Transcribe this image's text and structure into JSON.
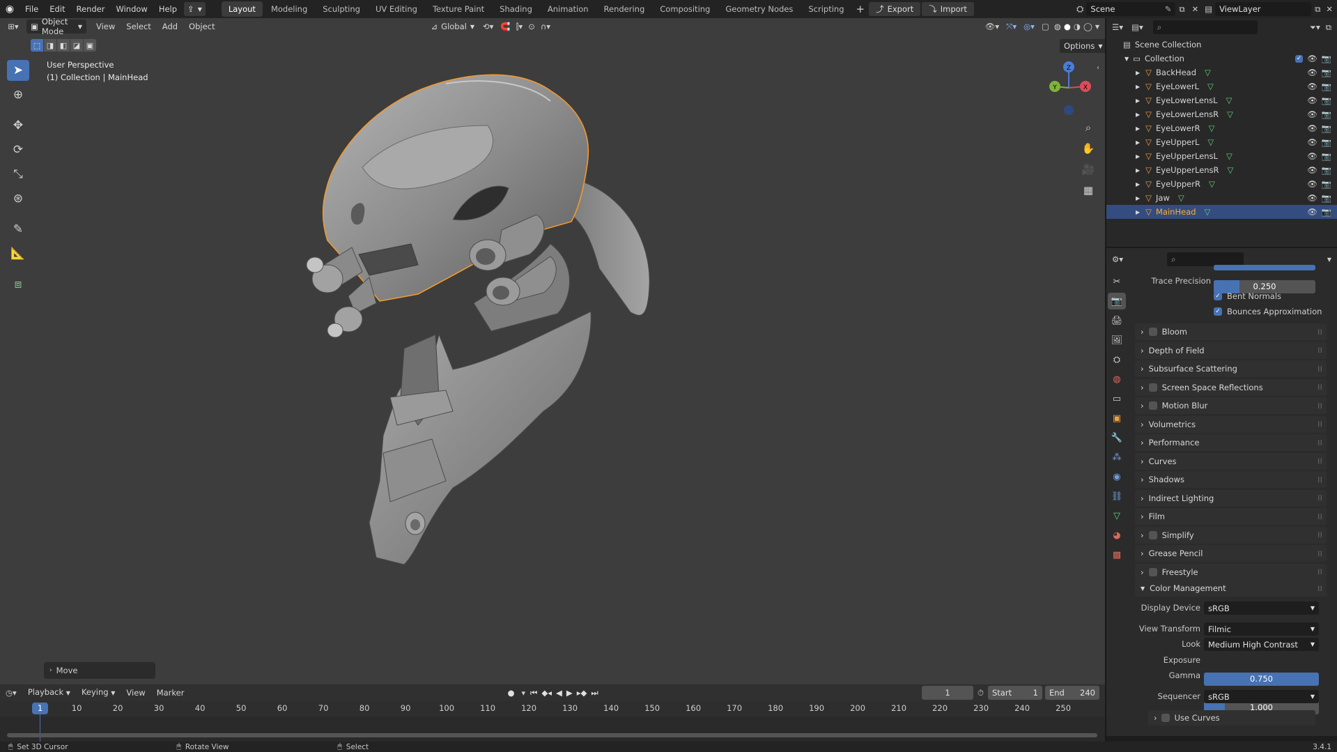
{
  "topbar": {
    "menus": [
      "File",
      "Edit",
      "Render",
      "Window",
      "Help"
    ],
    "workspaces": [
      "Layout",
      "Modeling",
      "Sculpting",
      "UV Editing",
      "Texture Paint",
      "Shading",
      "Animation",
      "Rendering",
      "Compositing",
      "Geometry Nodes",
      "Scripting"
    ],
    "active_workspace": "Layout",
    "export_label": "Export",
    "import_label": "Import",
    "scene": "Scene",
    "view_layer": "ViewLayer"
  },
  "viewport": {
    "mode": "Object Mode",
    "menus": [
      "View",
      "Select",
      "Add",
      "Object"
    ],
    "orientation": "Global",
    "options_label": "Options",
    "overlay_line1": "User Perspective",
    "overlay_line2": "(1) Collection | MainHead",
    "last_op": "Move",
    "gizmo_axes": {
      "z": "Z",
      "x": "X",
      "y": "Y"
    },
    "colors": {
      "background": "#3d3d3d",
      "selection_outline": "#f29a2e",
      "mesh": "#9a9a9a"
    }
  },
  "outliner": {
    "root": "Scene Collection",
    "collection": "Collection",
    "objects": [
      "BackHead",
      "EyeLowerL",
      "EyeLowerLensL",
      "EyeLowerLensR",
      "EyeLowerR",
      "EyeUpperL",
      "EyeUpperLensL",
      "EyeUpperLensR",
      "EyeUpperR",
      "Jaw",
      "MainHead"
    ],
    "selected": "MainHead"
  },
  "properties": {
    "trace_precision_label": "Trace Precision",
    "trace_precision_value": "0.250",
    "trace_precision_fraction": 0.25,
    "bent_normals": "Bent Normals",
    "bounces_approx": "Bounces Approximation",
    "panels": [
      {
        "label": "Bloom",
        "checkbox": true
      },
      {
        "label": "Depth of Field",
        "checkbox": false
      },
      {
        "label": "Subsurface Scattering",
        "checkbox": false
      },
      {
        "label": "Screen Space Reflections",
        "checkbox": true
      },
      {
        "label": "Motion Blur",
        "checkbox": true
      },
      {
        "label": "Volumetrics",
        "checkbox": false
      },
      {
        "label": "Performance",
        "checkbox": false
      },
      {
        "label": "Curves",
        "checkbox": false
      },
      {
        "label": "Shadows",
        "checkbox": false
      },
      {
        "label": "Indirect Lighting",
        "checkbox": false
      },
      {
        "label": "Film",
        "checkbox": false
      },
      {
        "label": "Simplify",
        "checkbox": true
      },
      {
        "label": "Grease Pencil",
        "checkbox": false
      },
      {
        "label": "Freestyle",
        "checkbox": true
      }
    ],
    "color_management": {
      "title": "Color Management",
      "display_device_label": "Display Device",
      "display_device": "sRGB",
      "view_transform_label": "View Transform",
      "view_transform": "Filmic",
      "look_label": "Look",
      "look": "Medium High Contrast",
      "exposure_label": "Exposure",
      "exposure": "0.750",
      "gamma_label": "Gamma",
      "gamma": "1.000",
      "sequencer_label": "Sequencer",
      "sequencer": "sRGB",
      "use_curves": "Use Curves"
    }
  },
  "timeline": {
    "menus": [
      "Playback",
      "Keying",
      "View",
      "Marker"
    ],
    "current_frame": "1",
    "start_label": "Start",
    "start": "1",
    "end_label": "End",
    "end": "240",
    "ticks": [
      "1",
      "10",
      "20",
      "30",
      "40",
      "50",
      "60",
      "70",
      "80",
      "90",
      "100",
      "110",
      "120",
      "130",
      "140",
      "150",
      "160",
      "170",
      "180",
      "190",
      "200",
      "210",
      "220",
      "230",
      "240",
      "250"
    ]
  },
  "statusbar": {
    "left": "Set 3D Cursor",
    "middle": "Rotate View",
    "right": "Select",
    "version": "3.4.1"
  }
}
